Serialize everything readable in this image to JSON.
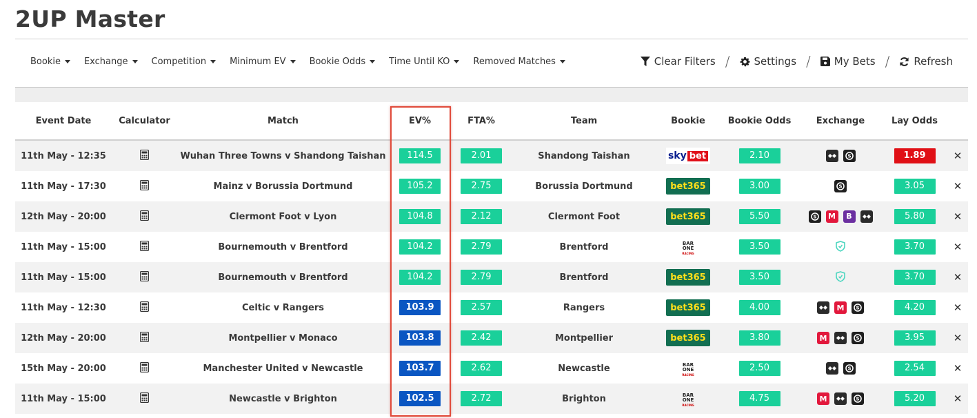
{
  "page": {
    "title": "2UP Master"
  },
  "filters": [
    {
      "label": "Bookie"
    },
    {
      "label": "Exchange"
    },
    {
      "label": "Competition"
    },
    {
      "label": "Minimum EV"
    },
    {
      "label": "Bookie Odds"
    },
    {
      "label": "Time Until KO"
    },
    {
      "label": "Removed Matches"
    }
  ],
  "actions": {
    "clear_filters": "Clear Filters",
    "settings": "Settings",
    "my_bets": "My Bets",
    "refresh": "Refresh",
    "separator": "/"
  },
  "table": {
    "headers": [
      "Event Date",
      "Calculator",
      "Match",
      "EV%",
      "FTA%",
      "Team",
      "Bookie",
      "Bookie Odds",
      "Exchange",
      "Lay Odds",
      ""
    ],
    "rows": [
      {
        "date": "11th May - 12:35",
        "match": "Wuhan Three Towns v Shandong Taishan",
        "ev": "114.5",
        "ev_color": "green",
        "fta": "2.01",
        "team": "Shandong Taishan",
        "bookie": "skybet",
        "bookie_odds": "2.10",
        "exchanges": [
          "betfair",
          "smarkets"
        ],
        "lay": "1.89",
        "lay_color": "red"
      },
      {
        "date": "11th May - 17:30",
        "match": "Mainz v Borussia Dortmund",
        "ev": "105.2",
        "ev_color": "green",
        "fta": "2.75",
        "team": "Borussia Dortmund",
        "bookie": "bet365",
        "bookie_odds": "3.00",
        "exchanges": [
          "smarkets"
        ],
        "lay": "3.05",
        "lay_color": "green"
      },
      {
        "date": "12th May - 20:00",
        "match": "Clermont Foot v Lyon",
        "ev": "104.8",
        "ev_color": "green",
        "fta": "2.12",
        "team": "Clermont Foot",
        "bookie": "bet365",
        "bookie_odds": "5.50",
        "exchanges": [
          "smarkets",
          "matchbook",
          "betdaq",
          "betfair"
        ],
        "lay": "5.80",
        "lay_color": "green"
      },
      {
        "date": "11th May - 15:00",
        "match": "Bournemouth v Brentford",
        "ev": "104.2",
        "ev_color": "green",
        "fta": "2.79",
        "team": "Brentford",
        "bookie": "barone",
        "bookie_odds": "3.50",
        "exchanges": [
          "shield"
        ],
        "lay": "3.70",
        "lay_color": "green"
      },
      {
        "date": "11th May - 15:00",
        "match": "Bournemouth v Brentford",
        "ev": "104.2",
        "ev_color": "green",
        "fta": "2.79",
        "team": "Brentford",
        "bookie": "bet365",
        "bookie_odds": "3.50",
        "exchanges": [
          "shield"
        ],
        "lay": "3.70",
        "lay_color": "green"
      },
      {
        "date": "11th May - 12:30",
        "match": "Celtic v Rangers",
        "ev": "103.9",
        "ev_color": "blue",
        "fta": "2.57",
        "team": "Rangers",
        "bookie": "bet365",
        "bookie_odds": "4.00",
        "exchanges": [
          "betfair",
          "matchbook",
          "smarkets"
        ],
        "lay": "4.20",
        "lay_color": "green"
      },
      {
        "date": "12th May - 20:00",
        "match": "Montpellier v Monaco",
        "ev": "103.8",
        "ev_color": "blue",
        "fta": "2.42",
        "team": "Montpellier",
        "bookie": "bet365",
        "bookie_odds": "3.80",
        "exchanges": [
          "matchbook",
          "betfair",
          "smarkets"
        ],
        "lay": "3.95",
        "lay_color": "green"
      },
      {
        "date": "15th May - 20:00",
        "match": "Manchester United v Newcastle",
        "ev": "103.7",
        "ev_color": "blue",
        "fta": "2.62",
        "team": "Newcastle",
        "bookie": "barone",
        "bookie_odds": "2.50",
        "exchanges": [
          "betfair",
          "smarkets"
        ],
        "lay": "2.54",
        "lay_color": "green"
      },
      {
        "date": "11th May - 15:00",
        "match": "Newcastle v Brighton",
        "ev": "102.5",
        "ev_color": "blue",
        "fta": "2.72",
        "team": "Brighton",
        "bookie": "barone",
        "bookie_odds": "4.75",
        "exchanges": [
          "matchbook",
          "betfair",
          "smarkets"
        ],
        "lay": "5.20",
        "lay_color": "green"
      }
    ]
  },
  "bookie_logos": {
    "bet365": "bet365",
    "skybet_sky": "sky",
    "skybet_bet": "bet",
    "barone_1": "BAR",
    "barone_2": "ONE",
    "barone_3": "RACING"
  },
  "exchange_glyphs": {
    "matchbook": "M",
    "betdaq": "B"
  },
  "remove_glyph": "✕",
  "colors": {
    "green_pill": "#1ad09a",
    "blue_pill": "#0a56c2",
    "red_pill": "#e01016",
    "bet365_bg": "#126e51",
    "bet365_text": "#ffdf1b",
    "highlight_border": "#e04a3a"
  },
  "icons": {
    "clear_filters": "filter-icon",
    "settings": "gear-icon",
    "my_bets": "save-icon",
    "refresh": "refresh-icon",
    "calculator": "calculator-icon",
    "remove": "close-icon"
  }
}
